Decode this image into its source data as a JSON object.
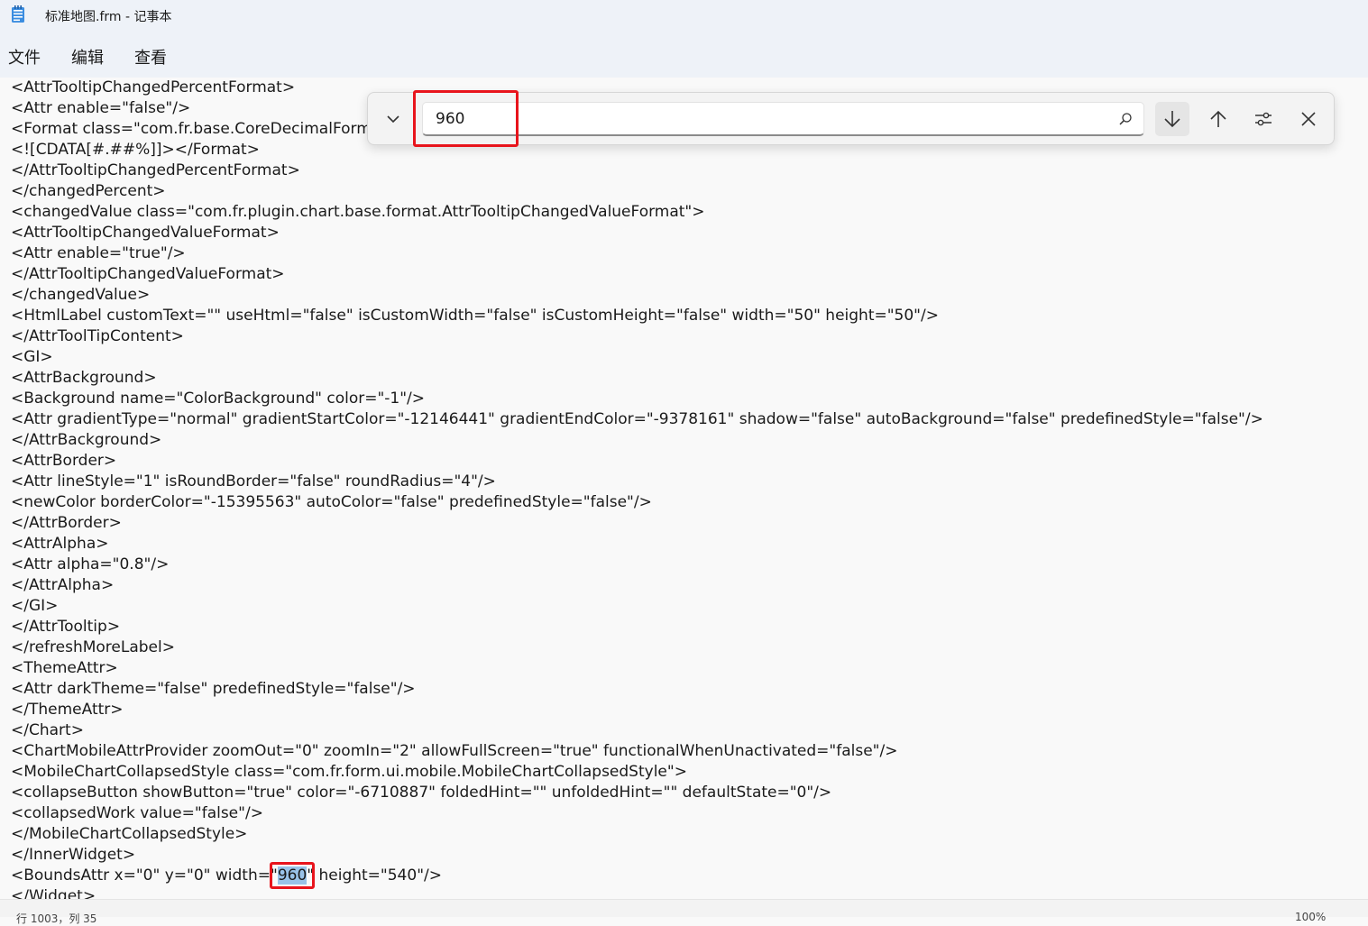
{
  "window": {
    "title": "标准地图.frm - 记事本",
    "icon": "notepad-icon"
  },
  "menu": {
    "items": [
      "文件",
      "编辑",
      "查看"
    ]
  },
  "find": {
    "query": "960",
    "expand_icon": "chevron-down-icon",
    "search_icon": "search-icon",
    "next_icon": "arrow-down-icon",
    "prev_icon": "arrow-up-icon",
    "options_icon": "sliders-icon",
    "close_icon": "close-icon"
  },
  "editor": {
    "lines": [
      "<AttrTooltipChangedPercentFormat>",
      "<Attr enable=\"false\"/>",
      "<Format class=\"com.fr.base.CoreDecimalFormat\">",
      "<![CDATA[#.##%]]></Format>",
      "</AttrTooltipChangedPercentFormat>",
      "</changedPercent>",
      "<changedValue class=\"com.fr.plugin.chart.base.format.AttrTooltipChangedValueFormat\">",
      "<AttrTooltipChangedValueFormat>",
      "<Attr enable=\"true\"/>",
      "</AttrTooltipChangedValueFormat>",
      "</changedValue>",
      "<HtmlLabel customText=\"\" useHtml=\"false\" isCustomWidth=\"false\" isCustomHeight=\"false\" width=\"50\" height=\"50\"/>",
      "</AttrToolTipContent>",
      "<GI>",
      "<AttrBackground>",
      "<Background name=\"ColorBackground\" color=\"-1\"/>",
      "<Attr gradientType=\"normal\" gradientStartColor=\"-12146441\" gradientEndColor=\"-9378161\" shadow=\"false\" autoBackground=\"false\" predefinedStyle=\"false\"/>",
      "</AttrBackground>",
      "<AttrBorder>",
      "<Attr lineStyle=\"1\" isRoundBorder=\"false\" roundRadius=\"4\"/>",
      "<newColor borderColor=\"-15395563\" autoColor=\"false\" predefinedStyle=\"false\"/>",
      "</AttrBorder>",
      "<AttrAlpha>",
      "<Attr alpha=\"0.8\"/>",
      "</AttrAlpha>",
      "</GI>",
      "</AttrTooltip>",
      "</refreshMoreLabel>",
      "<ThemeAttr>",
      "<Attr darkTheme=\"false\" predefinedStyle=\"false\"/>",
      "</ThemeAttr>",
      "</Chart>",
      "<ChartMobileAttrProvider zoomOut=\"0\" zoomIn=\"2\" allowFullScreen=\"true\" functionalWhenUnactivated=\"false\"/>",
      "<MobileChartCollapsedStyle class=\"com.fr.form.ui.mobile.MobileChartCollapsedStyle\">",
      "<collapseButton showButton=\"true\" color=\"-6710887\" foldedHint=\"\" unfoldedHint=\"\" defaultState=\"0\"/>",
      "<collapsedWork value=\"false\"/>",
      "</MobileChartCollapsedStyle>",
      "</InnerWidget>"
    ],
    "match_line": {
      "before": "<BoundsAttr x=\"0\" y=\"0\" width=\"",
      "match": "960",
      "after": "\" height=\"540\"/>"
    },
    "last_line": "</Widget>"
  },
  "status": {
    "position": "行 1003，列 35",
    "zoom": "100%"
  },
  "colors": {
    "highlight": "#99c2e8",
    "annotation": "#e8141c",
    "chrome": "#eef2f8",
    "editor_bg": "#f9f9f9"
  }
}
